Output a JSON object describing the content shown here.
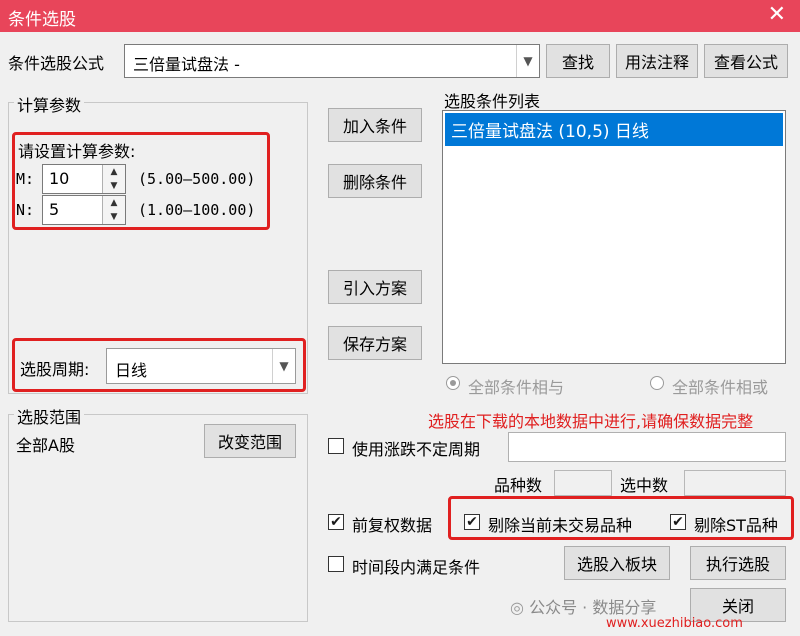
{
  "window": {
    "title": "条件选股",
    "close": "✕"
  },
  "formula": {
    "label": "条件选股公式",
    "value": "三倍量试盘法  -",
    "find": "查找",
    "usage": "用法注释",
    "view": "查看公式"
  },
  "params": {
    "group": "计算参数",
    "prompt": "请设置计算参数:",
    "m": {
      "label": "M:",
      "value": "10",
      "range": "(5.00—500.00)"
    },
    "n": {
      "label": "N:",
      "value": "5",
      "range": "(1.00—100.00)"
    }
  },
  "period": {
    "label": "选股周期:",
    "value": "日线"
  },
  "scope": {
    "group": "选股范围",
    "value": "全部A股",
    "change": "改变范围"
  },
  "middle": {
    "add": "加入条件",
    "delete": "删除条件",
    "import": "引入方案",
    "save": "保存方案"
  },
  "conditions": {
    "label": "选股条件列表",
    "items": [
      "三倍量试盘法 (10,5) 日线"
    ]
  },
  "logic": {
    "and": "全部条件相与",
    "or": "全部条件相或"
  },
  "warning": "选股在下载的本地数据中进行,请确保数据完整",
  "options": {
    "uncertain_period": "使用涨跌不定周期",
    "count_label": "品种数",
    "selected_label": "选中数",
    "adjust": "前复权数据",
    "exclude_untraded": "剔除当前未交易品种",
    "exclude_st": "剔除ST品种",
    "time_range": "时间段内满足条件"
  },
  "actions": {
    "to_block": "选股入板块",
    "execute": "执行选股",
    "close": "关闭"
  },
  "watermark": {
    "wechat": "公众号 · 数据分享",
    "site": "www.xuezhibiao.com"
  },
  "colors": {
    "title_bar": "#e8455a",
    "selection": "#0078d7",
    "warning": "#e02020"
  }
}
